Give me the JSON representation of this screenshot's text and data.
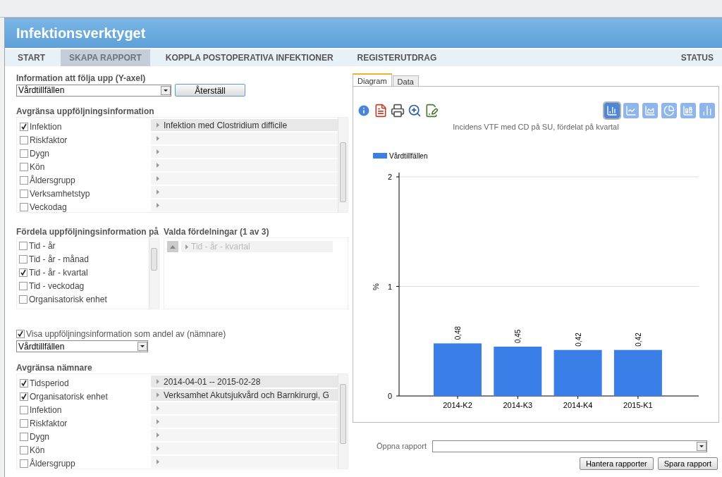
{
  "app": {
    "title": "Infektionsverktyget"
  },
  "nav": {
    "items": [
      {
        "label": "START",
        "selected": false
      },
      {
        "label": "SKAPA RAPPORT",
        "selected": true
      },
      {
        "label": "KOPPLA POSTOPERATIVA INFEKTIONER",
        "selected": false
      },
      {
        "label": "REGISTERUTDRAG",
        "selected": false
      }
    ],
    "status": "STATUS"
  },
  "y_axis": {
    "label": "Information att följa upp (Y-axel)",
    "value": "Vårdtillfällen",
    "reset": "Återställ"
  },
  "limit_info": {
    "title": "Avgränsa uppföljningsinformation",
    "items": [
      {
        "label": "Infektion",
        "checked": true,
        "value": "Infektion med Clostridium difficile"
      },
      {
        "label": "Riskfaktor",
        "checked": false
      },
      {
        "label": "Dygn",
        "checked": false
      },
      {
        "label": "Kön",
        "checked": false
      },
      {
        "label": "Åldersgrupp",
        "checked": false
      },
      {
        "label": "Verksamhetstyp",
        "checked": false
      },
      {
        "label": "Veckodag",
        "checked": false
      }
    ]
  },
  "distribute": {
    "title": "Fördela uppföljningsinformation på",
    "items": [
      {
        "label": "Tid - år",
        "checked": false
      },
      {
        "label": "Tid - år - månad",
        "checked": false
      },
      {
        "label": "Tid - år - kvartal",
        "checked": true
      },
      {
        "label": "Tid - veckodag",
        "checked": false
      },
      {
        "label": "Organisatorisk enhet",
        "checked": false
      }
    ]
  },
  "chosen": {
    "title": "Valda fördelningar (1 av 3)",
    "items": [
      {
        "label": "Tid - år - kvartal",
        "disabled": true
      }
    ]
  },
  "denominator": {
    "label": "Visa uppföljningsinformation som andel av (nämnare)",
    "checked": true,
    "value": "Vårdtillfällen"
  },
  "limit_denominator": {
    "title": "Avgränsa nämnare",
    "items": [
      {
        "label": "Tidsperiod",
        "checked": true,
        "value": "2014-04-01 -- 2015-02-28"
      },
      {
        "label": "Organisatorisk enhet",
        "checked": true,
        "value": "Verksamhet Akutsjukvård och Barnkirurgi, G"
      },
      {
        "label": "Infektion",
        "checked": false
      },
      {
        "label": "Riskfaktor",
        "checked": false
      },
      {
        "label": "Dygn",
        "checked": false
      },
      {
        "label": "Kön",
        "checked": false
      },
      {
        "label": "Åldersgrupp",
        "checked": false
      }
    ]
  },
  "tabs": [
    {
      "label": "Diagram",
      "selected": true
    },
    {
      "label": "Data",
      "selected": false
    }
  ],
  "chart_types": [
    {
      "kind": "bar",
      "selected": true
    },
    {
      "kind": "line",
      "selected": false
    },
    {
      "kind": "area",
      "selected": false
    },
    {
      "kind": "pie",
      "selected": false
    },
    {
      "kind": "stacked",
      "selected": false
    },
    {
      "kind": "grouped",
      "selected": false
    }
  ],
  "chart": {
    "chart_data": {
      "type": "bar",
      "title": "Incidens VTF med CD på SU, fördelat på kvartal",
      "ylabel": "%",
      "categories": [
        "2014-K2",
        "2014-K3",
        "2014-K4",
        "2015-K1"
      ],
      "series": [
        {
          "name": "Vårdtillfällen",
          "color": "#3a7fe8",
          "values": [
            0.48,
            0.45,
            0.42,
            0.42
          ]
        }
      ],
      "ylim": [
        0,
        2
      ],
      "yticks": [
        0,
        1,
        2
      ],
      "value_labels": [
        "0,48",
        "0,45",
        "0,42",
        "0,42"
      ]
    }
  },
  "open_report": {
    "label": "Öppna rapport"
  },
  "buttons": [
    "Hantera rapporter",
    "Spara rapport"
  ]
}
